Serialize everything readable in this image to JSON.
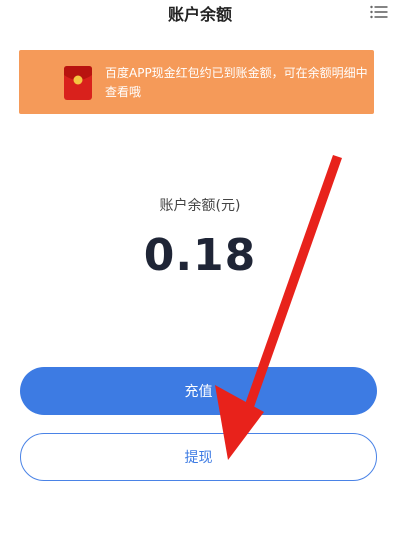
{
  "header": {
    "title": "账户余额",
    "menu_icon": "list-menu-icon"
  },
  "notice": {
    "icon": "red-envelope-icon",
    "text": "百度APP现金红包约已到账金额，可在余额明细中查看哦",
    "background": "#f59a59"
  },
  "balance": {
    "label": "账户余额(元)",
    "value": "0.18"
  },
  "buttons": {
    "recharge_label": "充值",
    "withdraw_label": "提现"
  },
  "colors": {
    "accent": "#3d7be3",
    "annotation_arrow": "#e8221b"
  }
}
